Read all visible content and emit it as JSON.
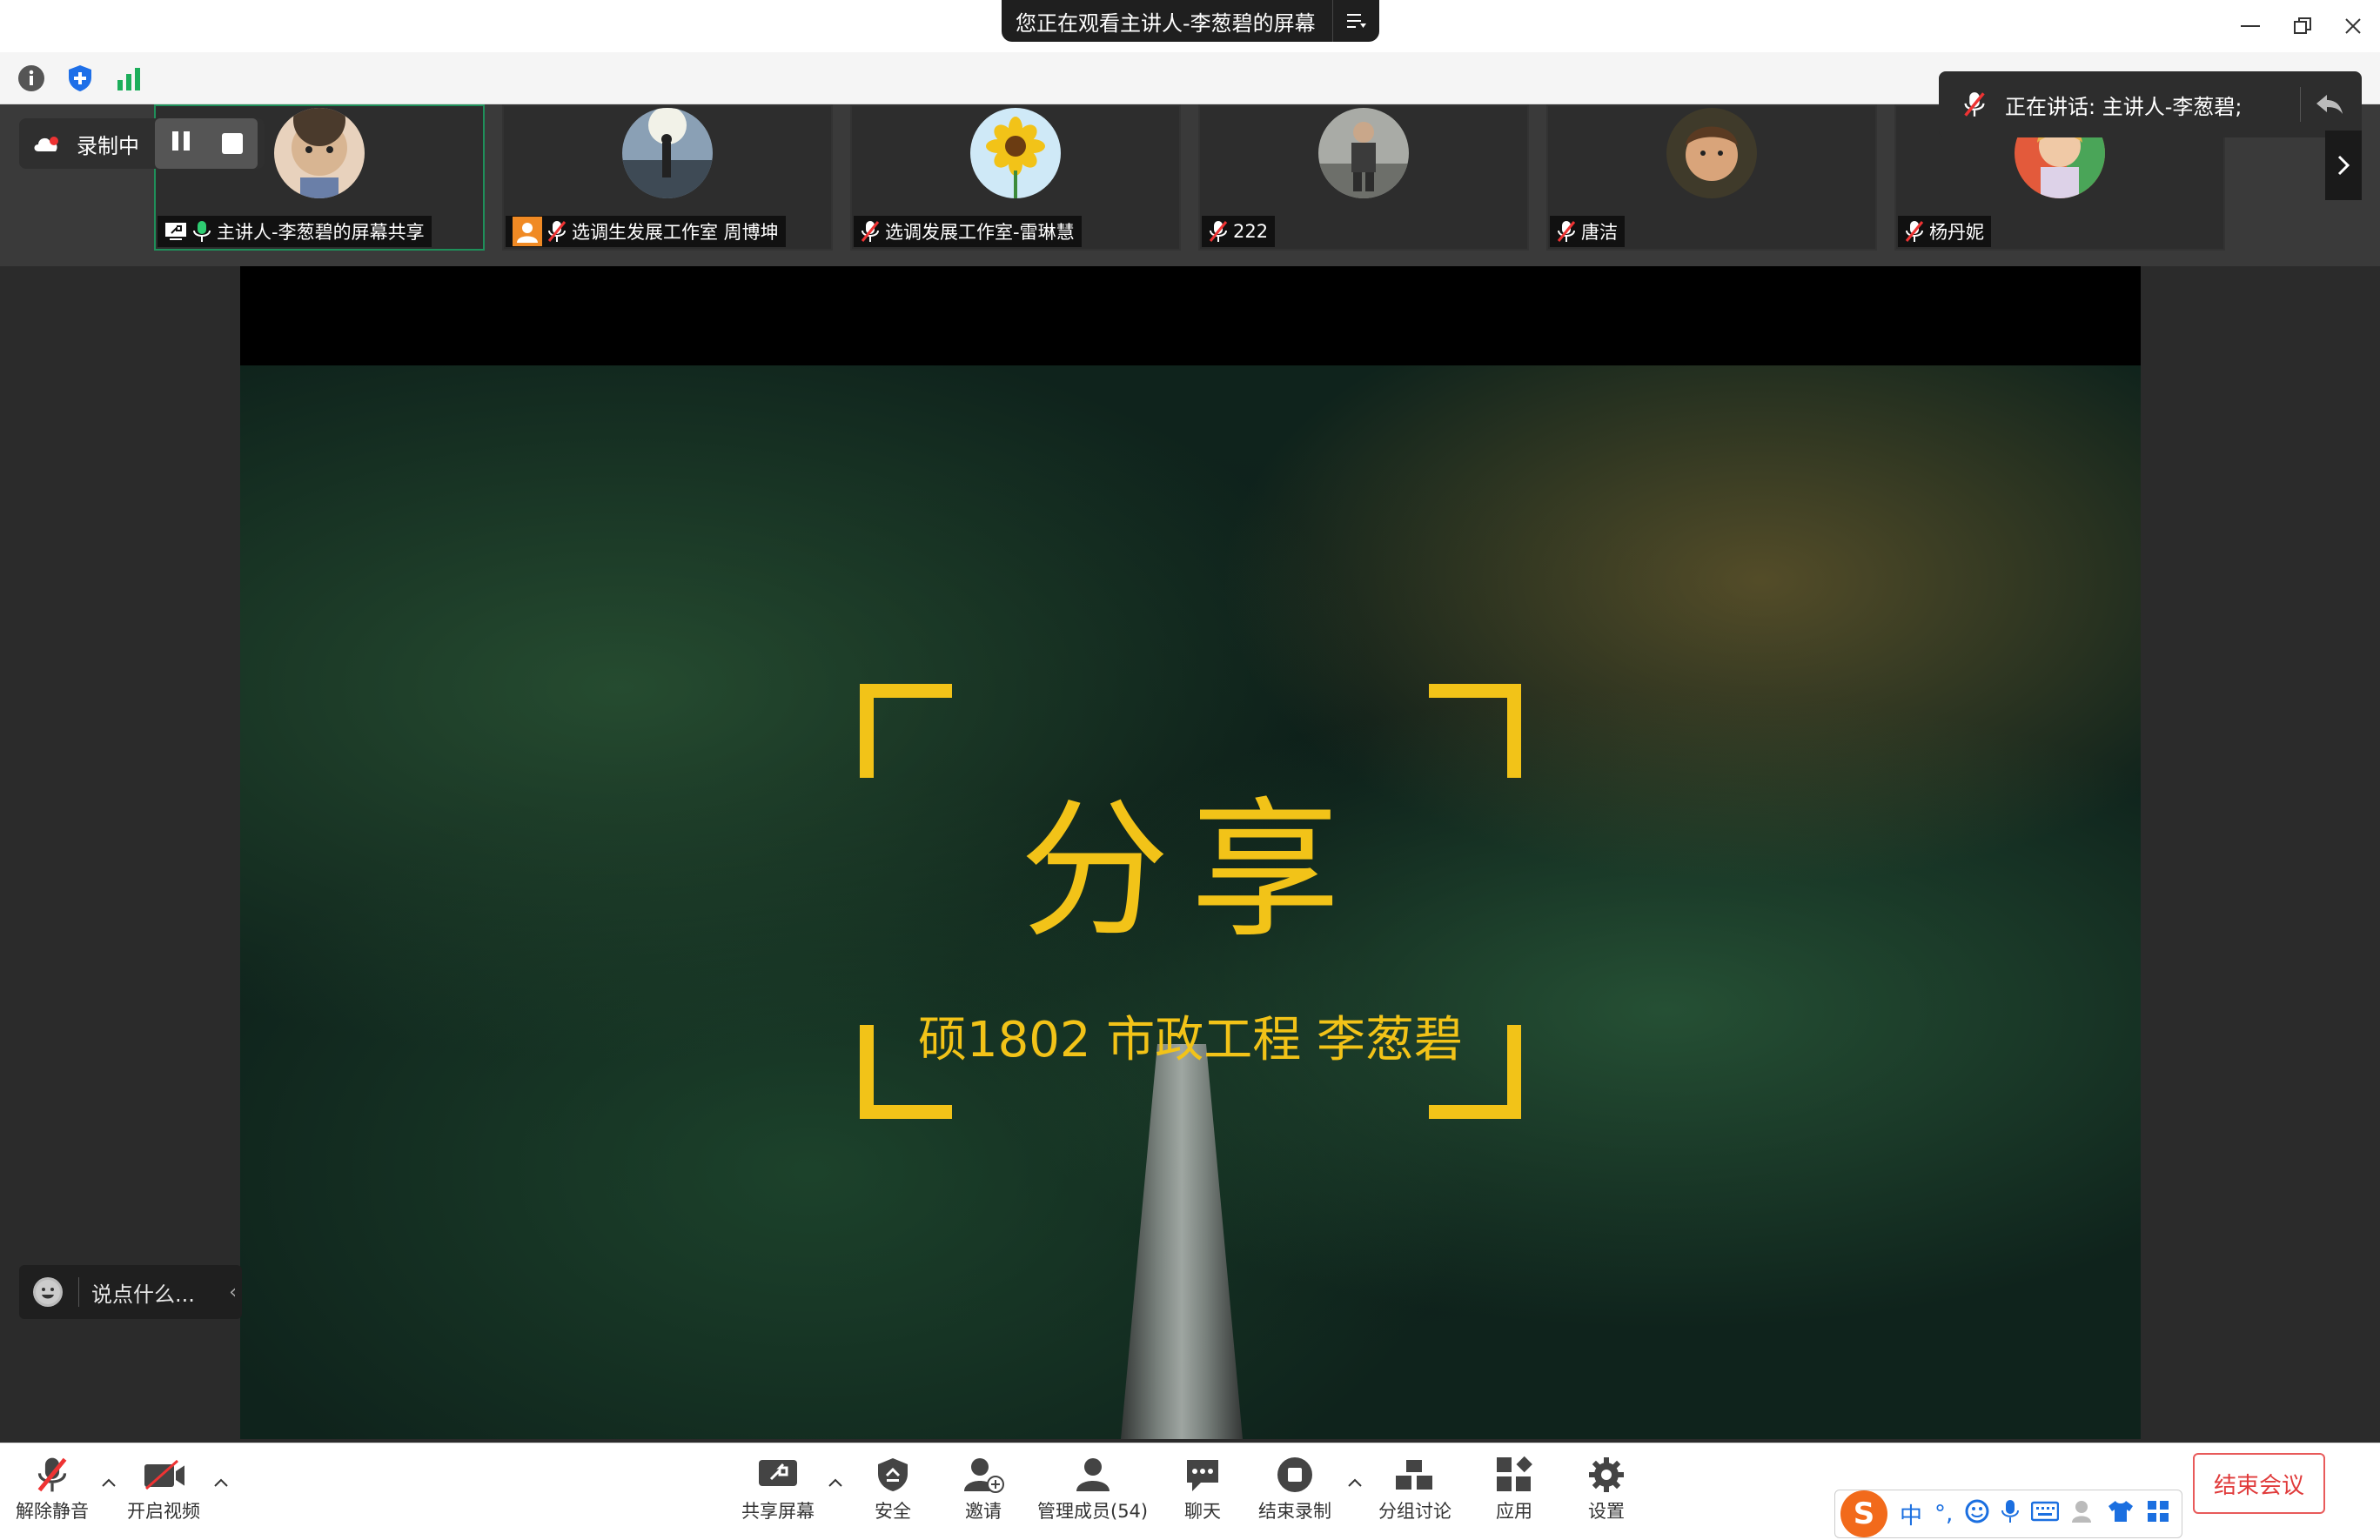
{
  "window": {
    "banner": "您正在观看主讲人-李葱碧的屏幕",
    "menu_icon": "list-menu-icon",
    "controls": [
      "minimize-icon",
      "restore-icon",
      "close-icon"
    ]
  },
  "top_strip": {
    "icons": [
      "info-icon",
      "shield-plus-icon",
      "signal-bars-icon"
    ]
  },
  "recording": {
    "label": "录制中",
    "icons": [
      "cloud-icon",
      "pause-icon",
      "stop-icon"
    ]
  },
  "participants": [
    {
      "label": "主讲人-李葱碧的屏幕共享",
      "mic": "mic-on",
      "active": true,
      "avatar_color": "#d8b592"
    },
    {
      "label": "选调生发展工作室 周博坤",
      "mic": "mic-muted",
      "active": false,
      "avatar_color": "#5b6b7a"
    },
    {
      "label": "选调发展工作室-雷琳慧",
      "mic": "mic-muted",
      "active": false,
      "avatar_color": "#f2c318"
    },
    {
      "label": "222",
      "mic": "mic-muted",
      "active": false,
      "avatar_color": "#8d8f8a"
    },
    {
      "label": "唐洁",
      "mic": "mic-muted",
      "active": false,
      "avatar_color": "#b3764a"
    },
    {
      "label": "杨丹妮",
      "mic": "mic-muted",
      "active": false,
      "avatar_color": "#e7b14a"
    }
  ],
  "speaking": {
    "label": "正在讲话: 主讲人-李葱碧;"
  },
  "slide": {
    "title": "分享",
    "subtitle": "硕1802 市政工程 李葱碧",
    "accent": "#f2c318"
  },
  "chat": {
    "placeholder": "说点什么..."
  },
  "bottom_toolbar": {
    "unmute": "解除静音",
    "start_video": "开启视频",
    "share_screen": "共享屏幕",
    "security": "安全",
    "invite": "邀请",
    "members": "管理成员(54)",
    "chat": "聊天",
    "end_recording": "结束录制",
    "breakout": "分组讨论",
    "apps": "应用",
    "settings": "设置",
    "end_meeting": "结束会议"
  },
  "ime": {
    "logo": "S",
    "mode": "中",
    "punct": "°,"
  }
}
